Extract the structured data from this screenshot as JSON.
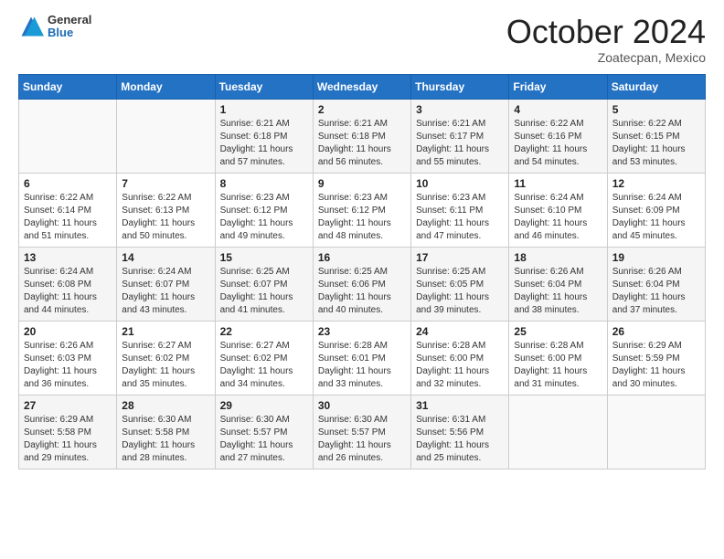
{
  "header": {
    "logo_general": "General",
    "logo_blue": "Blue",
    "month_title": "October 2024",
    "location": "Zoatecpan, Mexico"
  },
  "days_of_week": [
    "Sunday",
    "Monday",
    "Tuesday",
    "Wednesday",
    "Thursday",
    "Friday",
    "Saturday"
  ],
  "weeks": [
    [
      {
        "day": "",
        "info": ""
      },
      {
        "day": "",
        "info": ""
      },
      {
        "day": "1",
        "info": "Sunrise: 6:21 AM\nSunset: 6:18 PM\nDaylight: 11 hours and 57 minutes."
      },
      {
        "day": "2",
        "info": "Sunrise: 6:21 AM\nSunset: 6:18 PM\nDaylight: 11 hours and 56 minutes."
      },
      {
        "day": "3",
        "info": "Sunrise: 6:21 AM\nSunset: 6:17 PM\nDaylight: 11 hours and 55 minutes."
      },
      {
        "day": "4",
        "info": "Sunrise: 6:22 AM\nSunset: 6:16 PM\nDaylight: 11 hours and 54 minutes."
      },
      {
        "day": "5",
        "info": "Sunrise: 6:22 AM\nSunset: 6:15 PM\nDaylight: 11 hours and 53 minutes."
      }
    ],
    [
      {
        "day": "6",
        "info": "Sunrise: 6:22 AM\nSunset: 6:14 PM\nDaylight: 11 hours and 51 minutes."
      },
      {
        "day": "7",
        "info": "Sunrise: 6:22 AM\nSunset: 6:13 PM\nDaylight: 11 hours and 50 minutes."
      },
      {
        "day": "8",
        "info": "Sunrise: 6:23 AM\nSunset: 6:12 PM\nDaylight: 11 hours and 49 minutes."
      },
      {
        "day": "9",
        "info": "Sunrise: 6:23 AM\nSunset: 6:12 PM\nDaylight: 11 hours and 48 minutes."
      },
      {
        "day": "10",
        "info": "Sunrise: 6:23 AM\nSunset: 6:11 PM\nDaylight: 11 hours and 47 minutes."
      },
      {
        "day": "11",
        "info": "Sunrise: 6:24 AM\nSunset: 6:10 PM\nDaylight: 11 hours and 46 minutes."
      },
      {
        "day": "12",
        "info": "Sunrise: 6:24 AM\nSunset: 6:09 PM\nDaylight: 11 hours and 45 minutes."
      }
    ],
    [
      {
        "day": "13",
        "info": "Sunrise: 6:24 AM\nSunset: 6:08 PM\nDaylight: 11 hours and 44 minutes."
      },
      {
        "day": "14",
        "info": "Sunrise: 6:24 AM\nSunset: 6:07 PM\nDaylight: 11 hours and 43 minutes."
      },
      {
        "day": "15",
        "info": "Sunrise: 6:25 AM\nSunset: 6:07 PM\nDaylight: 11 hours and 41 minutes."
      },
      {
        "day": "16",
        "info": "Sunrise: 6:25 AM\nSunset: 6:06 PM\nDaylight: 11 hours and 40 minutes."
      },
      {
        "day": "17",
        "info": "Sunrise: 6:25 AM\nSunset: 6:05 PM\nDaylight: 11 hours and 39 minutes."
      },
      {
        "day": "18",
        "info": "Sunrise: 6:26 AM\nSunset: 6:04 PM\nDaylight: 11 hours and 38 minutes."
      },
      {
        "day": "19",
        "info": "Sunrise: 6:26 AM\nSunset: 6:04 PM\nDaylight: 11 hours and 37 minutes."
      }
    ],
    [
      {
        "day": "20",
        "info": "Sunrise: 6:26 AM\nSunset: 6:03 PM\nDaylight: 11 hours and 36 minutes."
      },
      {
        "day": "21",
        "info": "Sunrise: 6:27 AM\nSunset: 6:02 PM\nDaylight: 11 hours and 35 minutes."
      },
      {
        "day": "22",
        "info": "Sunrise: 6:27 AM\nSunset: 6:02 PM\nDaylight: 11 hours and 34 minutes."
      },
      {
        "day": "23",
        "info": "Sunrise: 6:28 AM\nSunset: 6:01 PM\nDaylight: 11 hours and 33 minutes."
      },
      {
        "day": "24",
        "info": "Sunrise: 6:28 AM\nSunset: 6:00 PM\nDaylight: 11 hours and 32 minutes."
      },
      {
        "day": "25",
        "info": "Sunrise: 6:28 AM\nSunset: 6:00 PM\nDaylight: 11 hours and 31 minutes."
      },
      {
        "day": "26",
        "info": "Sunrise: 6:29 AM\nSunset: 5:59 PM\nDaylight: 11 hours and 30 minutes."
      }
    ],
    [
      {
        "day": "27",
        "info": "Sunrise: 6:29 AM\nSunset: 5:58 PM\nDaylight: 11 hours and 29 minutes."
      },
      {
        "day": "28",
        "info": "Sunrise: 6:30 AM\nSunset: 5:58 PM\nDaylight: 11 hours and 28 minutes."
      },
      {
        "day": "29",
        "info": "Sunrise: 6:30 AM\nSunset: 5:57 PM\nDaylight: 11 hours and 27 minutes."
      },
      {
        "day": "30",
        "info": "Sunrise: 6:30 AM\nSunset: 5:57 PM\nDaylight: 11 hours and 26 minutes."
      },
      {
        "day": "31",
        "info": "Sunrise: 6:31 AM\nSunset: 5:56 PM\nDaylight: 11 hours and 25 minutes."
      },
      {
        "day": "",
        "info": ""
      },
      {
        "day": "",
        "info": ""
      }
    ]
  ]
}
